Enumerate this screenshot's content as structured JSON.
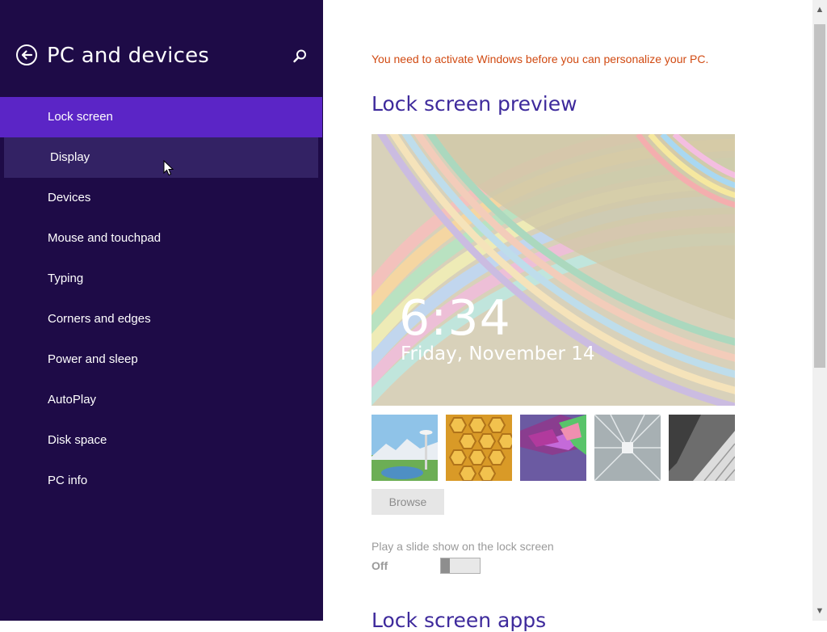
{
  "sidebar": {
    "title": "PC and devices",
    "back_icon": "back-arrow-icon",
    "search_icon": "search-icon",
    "items": [
      {
        "label": "Lock screen",
        "state": "selected"
      },
      {
        "label": "Display",
        "state": "hover"
      },
      {
        "label": "Devices"
      },
      {
        "label": "Mouse and touchpad"
      },
      {
        "label": "Typing"
      },
      {
        "label": "Corners and edges"
      },
      {
        "label": "Power and sleep"
      },
      {
        "label": "AutoPlay"
      },
      {
        "label": "Disk space"
      },
      {
        "label": "PC info"
      }
    ]
  },
  "main": {
    "warning": "You need to activate Windows before you can personalize your PC.",
    "preview_heading": "Lock screen preview",
    "preview": {
      "time": "6:34",
      "date": "Friday, November 14"
    },
    "thumbnails": [
      {
        "name": "seattle-space-needle"
      },
      {
        "name": "honeycomb"
      },
      {
        "name": "geometric-shapes"
      },
      {
        "name": "glass-walkway"
      },
      {
        "name": "piano-keys"
      }
    ],
    "browse_label": "Browse",
    "slideshow_label": "Play a slide show on the lock screen",
    "slideshow_state": "Off",
    "apps_heading": "Lock screen apps"
  },
  "colors": {
    "sidebar_bg": "#1e0b47",
    "selected_bg": "#5b25c6",
    "hover_bg": "#332264",
    "heading": "#3e2a9c",
    "warning": "#d14a12"
  }
}
